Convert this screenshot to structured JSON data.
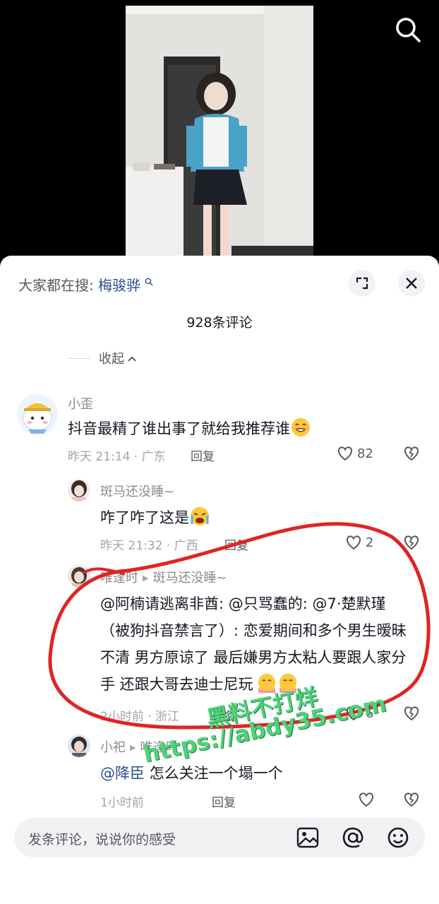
{
  "header": {
    "search_prefix": "大家都在搜:",
    "search_keyword": "梅骏骅",
    "comment_count": "928条评论",
    "collapse_label": "收起"
  },
  "comments": [
    {
      "username": "小歪",
      "text": "抖音最精了谁出事了就给我推荐谁",
      "meta": "昨天 21:14 · 广东",
      "reply_label": "回复",
      "likes": "82"
    },
    {
      "username": "斑马还没睡~",
      "text": "咋了咋了这是",
      "meta": "昨天 21:32 · 广西",
      "reply_label": "回复",
      "likes": "2"
    },
    {
      "username": "唯逢时",
      "reply_to": "斑马还没睡~",
      "text": "@阿楠请逃离非酋: @只骂蠢的: @7·楚默瑾（被狗抖音禁言了）: 恋爱期间和多个男生暧昧不清 男方原谅了 最后嫌男方太粘人要跟人家分手 还跟大哥去迪士尼玩",
      "meta": "2小时前 · 浙江",
      "reply_label": "回复",
      "likes": "6"
    },
    {
      "username": "小祀",
      "reply_to": "唯逢时",
      "mention": "@降臣",
      "text": "怎么关注一个塌一个",
      "meta": "1小时前",
      "reply_label": "回复"
    }
  ],
  "input": {
    "placeholder": "发条评论，说说你的感受"
  },
  "watermark": {
    "line1": "黑料不打烊",
    "line2": "https://abdy35.com"
  },
  "colors": {
    "link": "#2a4f8c",
    "annotation": "#e02424",
    "watermark": "#4fd27a"
  },
  "icons": [
    "search-icon",
    "expand-icon",
    "close-icon",
    "chevron-up-icon",
    "heart-icon",
    "broken-heart-icon",
    "image-icon",
    "at-icon",
    "emoji-icon"
  ]
}
